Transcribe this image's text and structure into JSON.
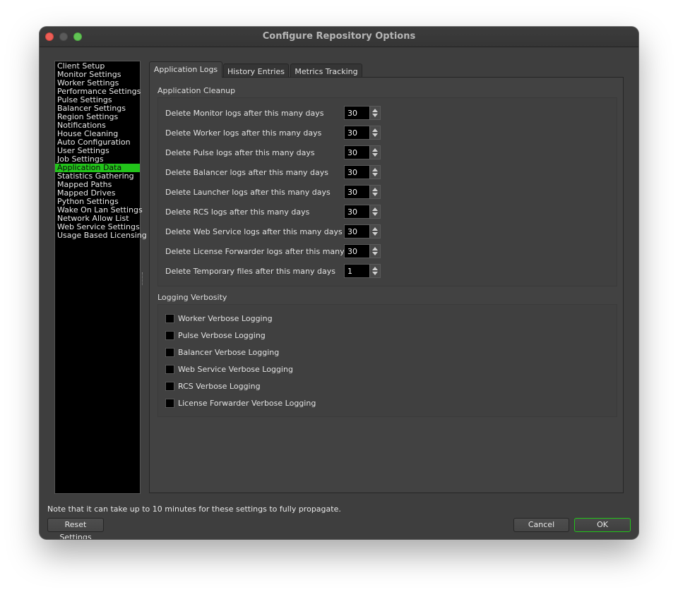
{
  "window": {
    "title": "Configure Repository Options"
  },
  "sidebar": {
    "items": [
      {
        "label": "Client Setup",
        "selected": false
      },
      {
        "label": "Monitor Settings",
        "selected": false
      },
      {
        "label": "Worker Settings",
        "selected": false
      },
      {
        "label": "Performance Settings",
        "selected": false
      },
      {
        "label": "Pulse Settings",
        "selected": false
      },
      {
        "label": "Balancer Settings",
        "selected": false
      },
      {
        "label": "Region Settings",
        "selected": false
      },
      {
        "label": "Notifications",
        "selected": false
      },
      {
        "label": "House Cleaning",
        "selected": false
      },
      {
        "label": "Auto Configuration",
        "selected": false
      },
      {
        "label": "User Settings",
        "selected": false
      },
      {
        "label": "Job Settings",
        "selected": false
      },
      {
        "label": "Application Data",
        "selected": true
      },
      {
        "label": "Statistics Gathering",
        "selected": false
      },
      {
        "label": "Mapped Paths",
        "selected": false
      },
      {
        "label": "Mapped Drives",
        "selected": false
      },
      {
        "label": "Python Settings",
        "selected": false
      },
      {
        "label": "Wake On Lan Settings",
        "selected": false
      },
      {
        "label": "Network Allow List",
        "selected": false
      },
      {
        "label": "Web Service Settings",
        "selected": false
      },
      {
        "label": "Usage Based Licensing",
        "selected": false
      }
    ],
    "selected_color": "#22c41a"
  },
  "tabs": [
    {
      "label": "Application Logs",
      "active": true
    },
    {
      "label": "History Entries",
      "active": false
    },
    {
      "label": "Metrics Tracking",
      "active": false
    }
  ],
  "cleanup": {
    "title": "Application Cleanup",
    "rows": [
      {
        "label": "Delete Monitor logs after this many days",
        "value": "30"
      },
      {
        "label": "Delete Worker logs after this many days",
        "value": "30"
      },
      {
        "label": "Delete Pulse logs after this many days",
        "value": "30"
      },
      {
        "label": "Delete Balancer logs after this many days",
        "value": "30"
      },
      {
        "label": "Delete Launcher logs after this many days",
        "value": "30"
      },
      {
        "label": "Delete RCS logs after this many days",
        "value": "30"
      },
      {
        "label": "Delete Web Service logs after this many days",
        "value": "30"
      },
      {
        "label": "Delete License Forwarder logs after this many days",
        "value": "30"
      },
      {
        "label": "Delete Temporary files after this many days",
        "value": "1"
      }
    ]
  },
  "verbosity": {
    "title": "Logging Verbosity",
    "options": [
      {
        "label": "Worker Verbose Logging",
        "checked": false
      },
      {
        "label": "Pulse Verbose Logging",
        "checked": false
      },
      {
        "label": "Balancer Verbose Logging",
        "checked": false
      },
      {
        "label": "Web Service Verbose Logging",
        "checked": false
      },
      {
        "label": "RCS Verbose Logging",
        "checked": false
      },
      {
        "label": "License Forwarder Verbose Logging",
        "checked": false
      }
    ]
  },
  "footer": {
    "note": "Note that it can take up to 10 minutes for these settings to fully propagate.",
    "reset_label": "Reset Settings",
    "cancel_label": "Cancel",
    "ok_label": "OK"
  }
}
